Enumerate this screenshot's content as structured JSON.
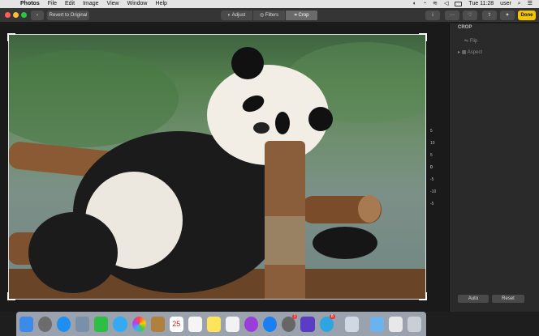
{
  "menubar": {
    "app": "Photos",
    "items": [
      "File",
      "Edit",
      "Image",
      "View",
      "Window",
      "Help"
    ],
    "clock": "Tue 11:28",
    "user": "user"
  },
  "toolbar": {
    "revert_label": "Revert to Original",
    "tabs": [
      {
        "label": "Adjust",
        "active": false
      },
      {
        "label": "Filters",
        "active": false
      },
      {
        "label": "Crop",
        "active": true
      }
    ],
    "done_label": "Done"
  },
  "dial": {
    "ticks": [
      "5",
      "10",
      "5",
      "0",
      "-5",
      "-10",
      "-5"
    ]
  },
  "sidebar": {
    "title": "CROP",
    "flip_label": "Flip",
    "aspect_label": "Aspect",
    "auto_label": "Auto",
    "reset_label": "Reset"
  },
  "photo": {
    "subject": "giant panda on wooden logs"
  },
  "dock": {
    "apps": [
      "finder",
      "launchpad",
      "safari",
      "photo-booth",
      "facetime",
      "messages",
      "photos",
      "notes",
      "calendar",
      "reminders",
      "stickies",
      "music",
      "podcasts",
      "app-store",
      "system-preferences",
      "imovie",
      "telegram",
      "preview",
      "folder",
      "textedit",
      "trash"
    ],
    "calendar_date": "25",
    "system_prefs_badge": "1",
    "telegram_badge": "8"
  },
  "colors": {
    "accent": "#f2c500",
    "chrome": "#353535",
    "sidebar": "#2a2a2a"
  }
}
